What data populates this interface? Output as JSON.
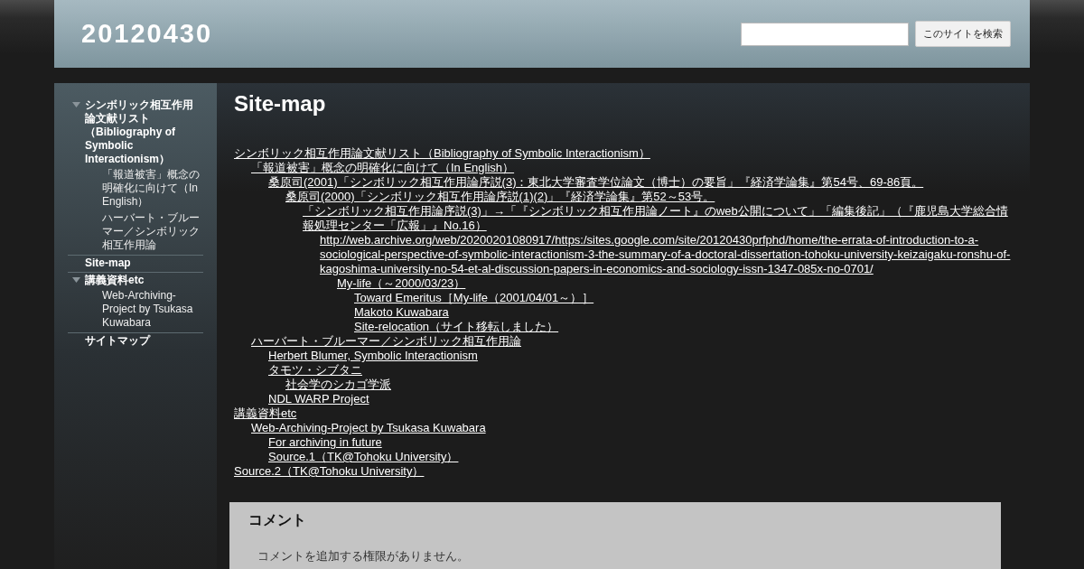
{
  "site_title": "20120430",
  "search": {
    "button": "このサイトを検索"
  },
  "sidebar": {
    "items": [
      {
        "label": "シンボリック相互作用論文献リスト（Bibliography of Symbolic Interactionism）",
        "expanded": true,
        "children": [
          {
            "label": "「報道被害」概念の明確化に向けて（In English）"
          },
          {
            "label": "ハーバート・ブルーマー／シンボリック相互作用論"
          }
        ]
      },
      {
        "label": "Site-map"
      },
      {
        "label": "講義資料etc",
        "expanded": true,
        "children": [
          {
            "label": "Web-Archiving-Project by Tsukasa Kuwabara"
          }
        ]
      },
      {
        "label": "サイトマップ"
      }
    ]
  },
  "page_title": "Site-map",
  "sitemap": [
    {
      "label": "シンボリック相互作用論文献リスト（Bibliography of Symbolic Interactionism）",
      "children": [
        {
          "label": "「報道被害」概念の明確化に向けて（In English）",
          "children": [
            {
              "label": "桑原司(2001)「シンボリック相互作用論序説(3)：東北大学審査学位論文（博士）の要旨」『経済学論集』第54号、69-86頁。",
              "children": [
                {
                  "label": "桑原司(2000)「シンボリック相互作用論序説(1)(2)」『経済学論集』第52～53号。",
                  "children": [
                    {
                      "label": "「シンボリック相互作用論序説(3)」→「『シンボリック相互作用論ノート』のweb公開について」「編集後記」（『鹿児島大学総合情報処理センター「広報」』No.16）",
                      "children": [
                        {
                          "label": "http://web.archive.org/web/20200201080917/https:/sites.google.com/site/20120430prfphd/home/the-errata-of-introduction-to-a-sociological-perspective-of-symbolic-interactionism-3-the-summary-of-a-doctoral-dissertation-tohoku-university-keizaigaku-ronshu-of-kagoshima-university-no-54-et-al-discussion-papers-in-economics-and-sociology-issn-1347-085x-no-0701/",
                          "children": [
                            {
                              "label": "My-life（～2000/03/23）",
                              "children": [
                                {
                                  "label": "Toward Emeritus［My-life（2001/04/01～）］"
                                },
                                {
                                  "label": "Makoto Kuwabara"
                                },
                                {
                                  "label": "Site-relocation（サイト移転しました）"
                                }
                              ]
                            }
                          ]
                        }
                      ]
                    }
                  ]
                }
              ]
            }
          ]
        },
        {
          "label": "ハーバート・ブルーマー／シンボリック相互作用論",
          "children": [
            {
              "label": "Herbert Blumer, Symbolic Interactionism"
            },
            {
              "label": "タモツ・シブタニ",
              "children": [
                {
                  "label": "社会学のシカゴ学派"
                }
              ]
            },
            {
              "label": "NDL WARP Project"
            }
          ]
        }
      ]
    },
    {
      "label": "講義資料etc",
      "children": [
        {
          "label": "Web-Archiving-Project by Tsukasa Kuwabara",
          "children": [
            {
              "label": "For archiving in future"
            },
            {
              "label": "Source.1（TK@Tohoku University）"
            }
          ]
        }
      ]
    },
    {
      "label": "Source.2（TK@Tohoku University）"
    }
  ],
  "comments": {
    "heading": "コメント",
    "message": "コメントを追加する権限がありません。"
  }
}
